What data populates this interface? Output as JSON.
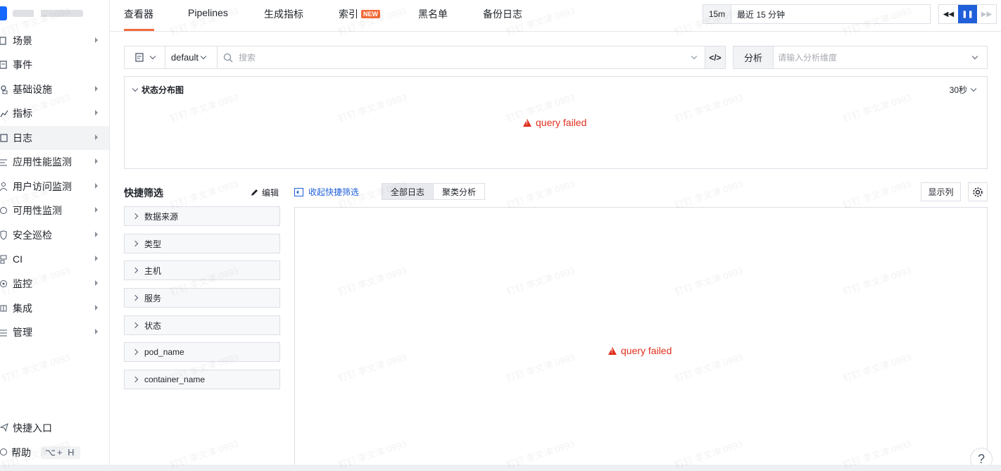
{
  "sidebar": {
    "items": [
      {
        "label": "场景",
        "icon": "scene-icon",
        "arrow": true
      },
      {
        "label": "事件",
        "icon": "event-icon",
        "arrow": false
      },
      {
        "label": "基础设施",
        "icon": "infrastructure-icon",
        "arrow": true
      },
      {
        "label": "指标",
        "icon": "metrics-icon",
        "arrow": true
      },
      {
        "label": "日志",
        "icon": "log-icon",
        "arrow": true,
        "active": true
      },
      {
        "label": "应用性能监测",
        "icon": "apm-icon",
        "arrow": true
      },
      {
        "label": "用户访问监测",
        "icon": "rum-icon",
        "arrow": true
      },
      {
        "label": "可用性监测",
        "icon": "availability-icon",
        "arrow": true
      },
      {
        "label": "安全巡检",
        "icon": "security-icon",
        "arrow": true
      },
      {
        "label": "CI",
        "icon": "ci-icon",
        "arrow": true
      },
      {
        "label": "监控",
        "icon": "monitor-icon",
        "arrow": true
      },
      {
        "label": "集成",
        "icon": "integration-icon",
        "arrow": true
      },
      {
        "label": "管理",
        "icon": "manage-icon",
        "arrow": true
      }
    ],
    "shortcut": "快捷入口",
    "help": "帮助",
    "help_kbd": "⌥+ H"
  },
  "tabs": [
    {
      "label": "查看器",
      "active": true
    },
    {
      "label": "Pipelines"
    },
    {
      "label": "生成指标"
    },
    {
      "label": "索引",
      "badge": "NEW"
    },
    {
      "label": "黑名单"
    },
    {
      "label": "备份日志"
    }
  ],
  "time": {
    "quick": "15m",
    "range": "最近 15 分钟"
  },
  "query": {
    "index": "default",
    "search_placeholder": "搜索",
    "code_icon": "</>"
  },
  "analysis": {
    "label": "分析",
    "placeholder": "请输入分析维度"
  },
  "distribution": {
    "title": "状态分布图",
    "interval": "30秒",
    "error": "query failed"
  },
  "quick_filter": {
    "title": "快捷筛选",
    "edit": "编辑",
    "collapse": "收起快捷筛选",
    "fields": [
      "数据来源",
      "类型",
      "主机",
      "服务",
      "状态",
      "pod_name",
      "container_name"
    ]
  },
  "log_view": {
    "modes": [
      "全部日志",
      "聚类分析"
    ],
    "columns_button": "显示列",
    "error": "query failed"
  },
  "help_fab": "?",
  "watermark": "钉钉 李文津 0993",
  "colors": {
    "accent": "#f26b3a",
    "primary": "#1f5fd9",
    "error": "#e0301e"
  }
}
